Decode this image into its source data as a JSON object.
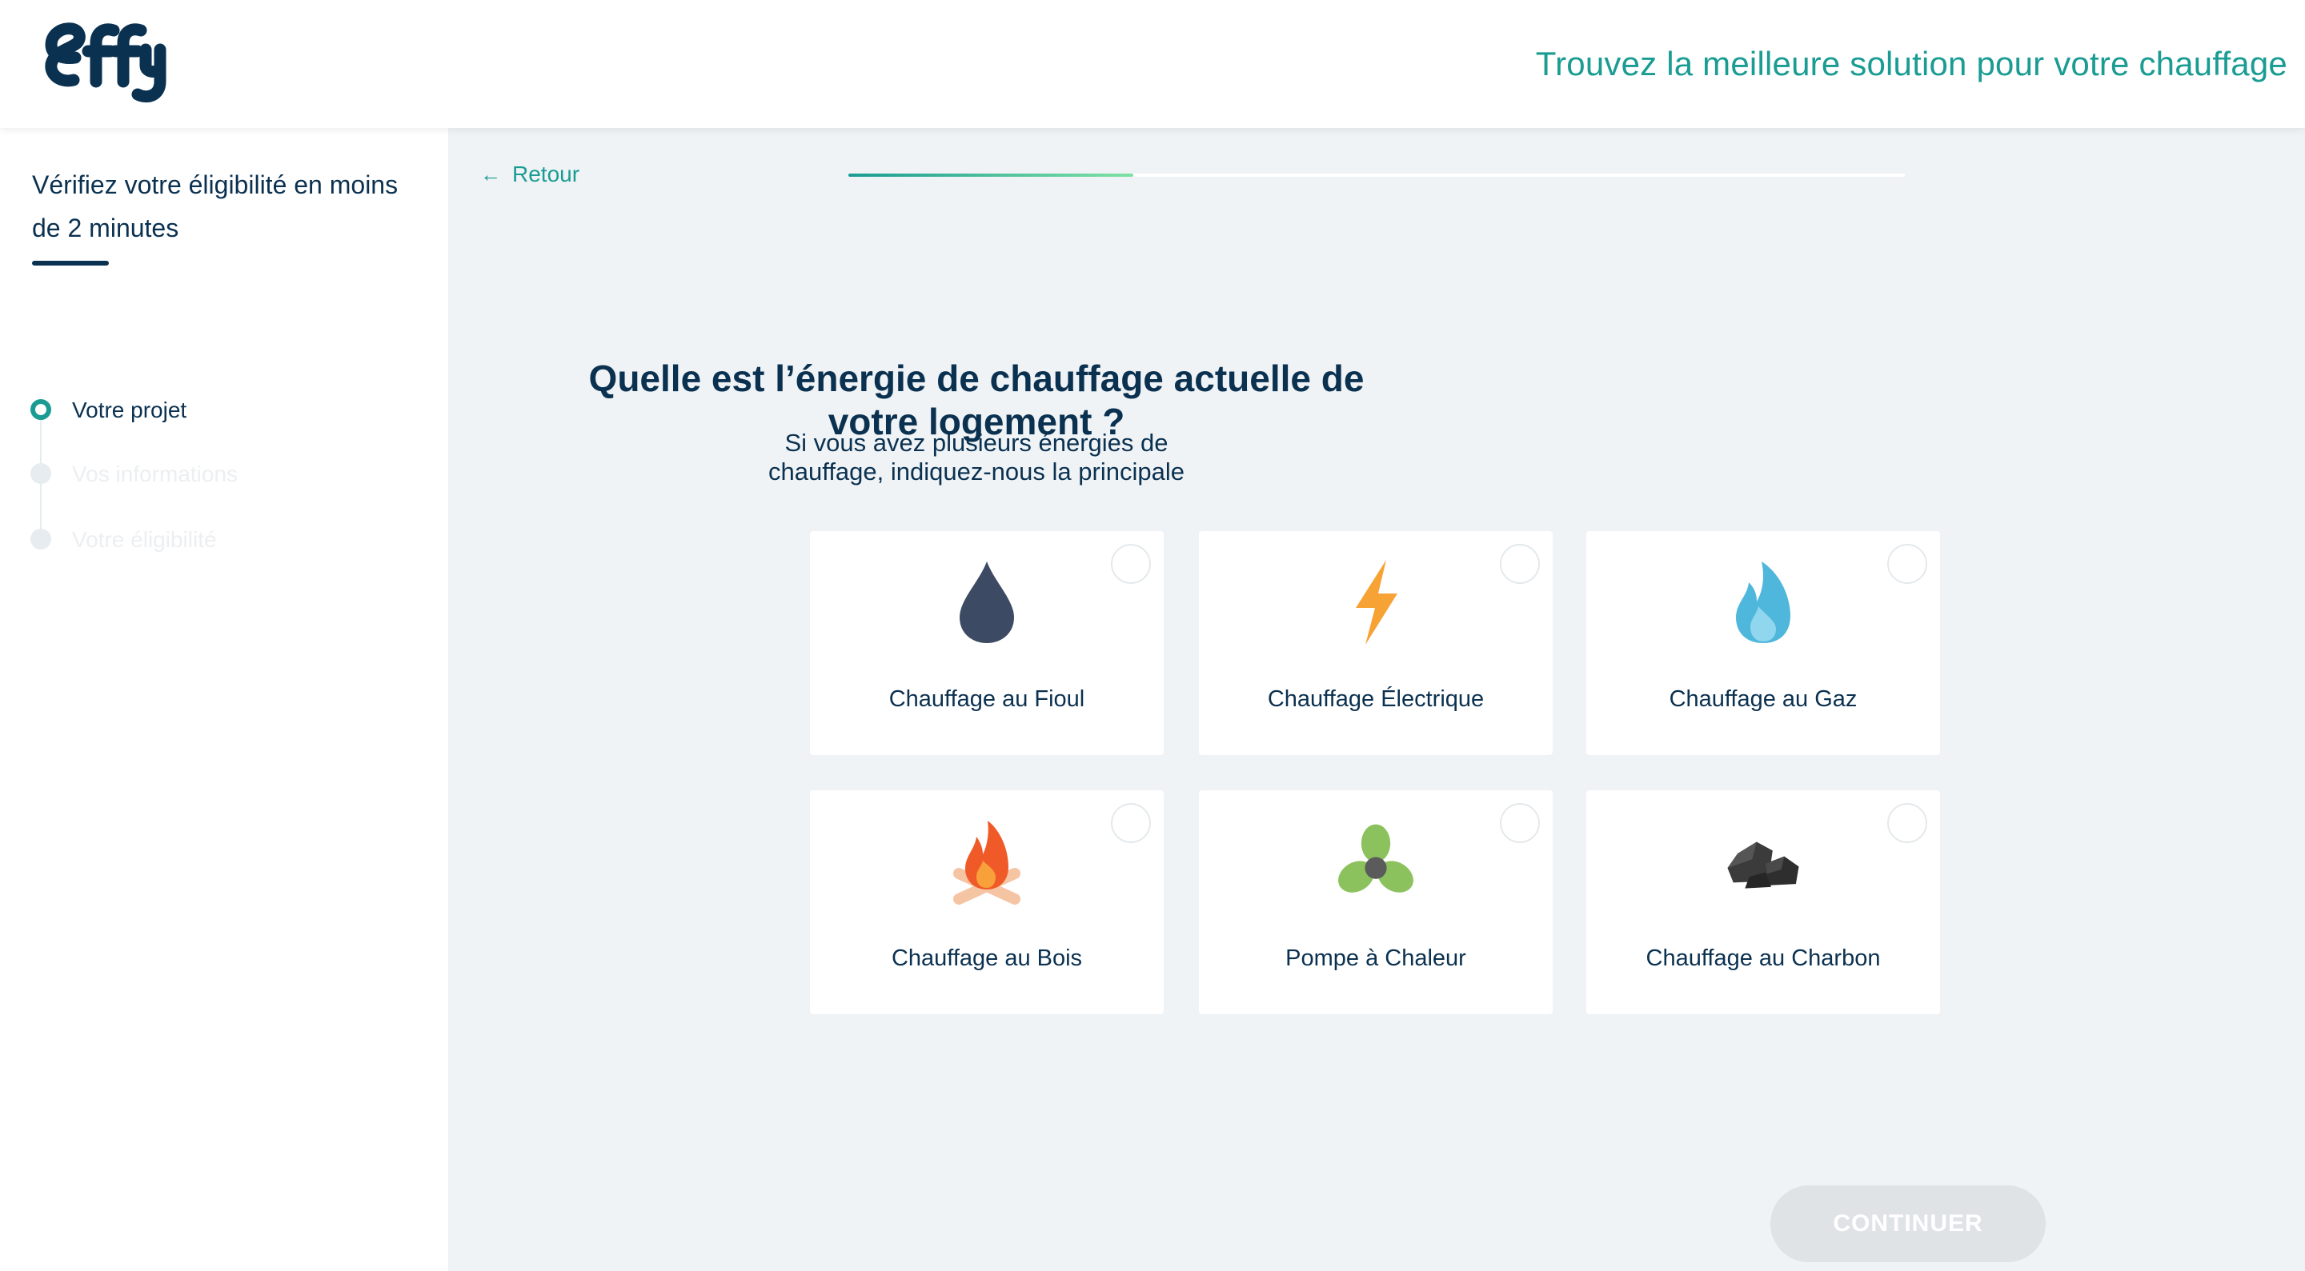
{
  "header": {
    "logo_text": "effy",
    "tagline": "Trouvez la meilleure solution pour votre chauffage"
  },
  "sidebar": {
    "title": "Vérifiez votre éligibilité en moins de 2 minutes",
    "steps": [
      {
        "label": "Votre projet",
        "state": "active"
      },
      {
        "label": "Vos informations",
        "state": "inactive"
      },
      {
        "label": "Votre éligibilité",
        "state": "inactive"
      }
    ]
  },
  "nav": {
    "back_label": "Retour",
    "progress": 0.27
  },
  "main": {
    "question": "Quelle est l’énergie de chauffage actuelle de votre logement ?",
    "hint": "Si vous avez plusieurs énergies de chauffage, indiquez-nous la principale",
    "options": [
      {
        "label": "Chauffage au Fioul",
        "icon": "oil-drop-icon"
      },
      {
        "label": "Chauffage Électrique",
        "icon": "lightning-icon"
      },
      {
        "label": "Chauffage au Gaz",
        "icon": "gas-flame-icon"
      },
      {
        "label": "Chauffage au Bois",
        "icon": "wood-fire-icon"
      },
      {
        "label": "Pompe à Chaleur",
        "icon": "heat-pump-fan-icon"
      },
      {
        "label": "Chauffage au Charbon",
        "icon": "coal-icon"
      }
    ],
    "continue_label": "CONTINUER"
  },
  "colors": {
    "brand_dark": "#0b3150",
    "accent": "#1a9c93",
    "background": "#eff3f6",
    "button_disabled": "#dfe3e6"
  }
}
